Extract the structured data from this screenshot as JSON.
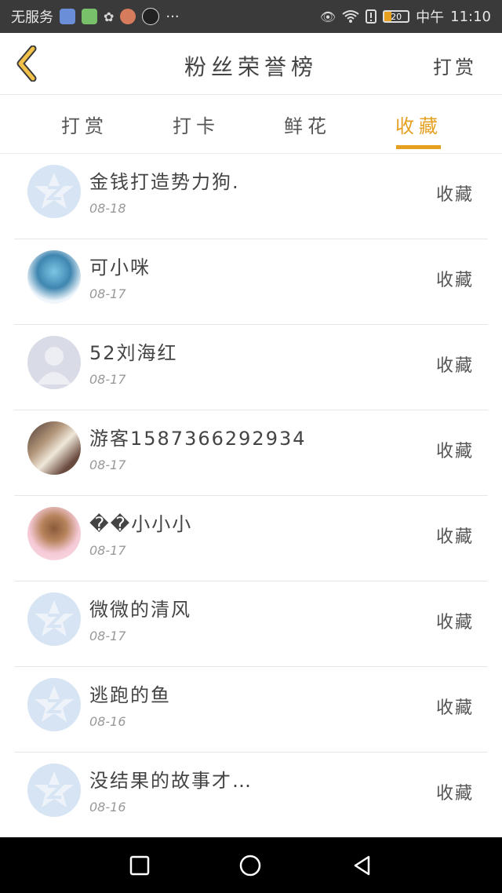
{
  "status_bar": {
    "carrier": "无服务",
    "time": "11:10",
    "period": "中午",
    "battery": "20",
    "more": "···",
    "app_icons": [
      "app-icon-1",
      "app-icon-2",
      "app-icon-3",
      "app-icon-4",
      "app-icon-5"
    ],
    "right_icons": [
      "eye-icon",
      "wifi-icon",
      "alert-icon",
      "battery-icon"
    ]
  },
  "header": {
    "title": "粉丝荣誉榜",
    "right_action": "打赏",
    "back_icon": "chevron-left-icon"
  },
  "tabs": [
    {
      "label": "打赏",
      "active": false
    },
    {
      "label": "打卡",
      "active": false
    },
    {
      "label": "鲜花",
      "active": false
    },
    {
      "label": "收藏",
      "active": true
    }
  ],
  "accent_color": "#e6a020",
  "list": [
    {
      "name": "金钱打造势力狗.",
      "date": "08-18",
      "action": "收藏",
      "avatar": "default-avatar"
    },
    {
      "name": "可小咪",
      "date": "08-17",
      "action": "收藏",
      "avatar": "anime-avatar"
    },
    {
      "name": "52刘海红",
      "date": "08-17",
      "action": "收藏",
      "avatar": "person-placeholder-avatar"
    },
    {
      "name": "游客1587366292934",
      "date": "08-17",
      "action": "收藏",
      "avatar": "photo-avatar"
    },
    {
      "name": "��小小小",
      "date": "08-17",
      "action": "收藏",
      "avatar": "girl-avatar"
    },
    {
      "name": "微微的清风",
      "date": "08-17",
      "action": "收藏",
      "avatar": "default-avatar"
    },
    {
      "name": "逃跑的鱼",
      "date": "08-16",
      "action": "收藏",
      "avatar": "default-avatar"
    },
    {
      "name": "没结果的故事才…",
      "date": "08-16",
      "action": "收藏",
      "avatar": "default-avatar"
    }
  ],
  "nav": {
    "icons": [
      "square-icon",
      "circle-icon",
      "triangle-back-icon"
    ]
  }
}
